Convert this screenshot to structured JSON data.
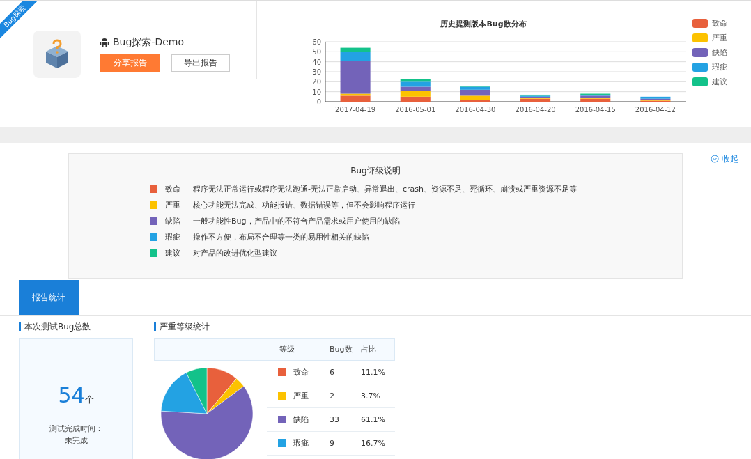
{
  "ribbon": "Bug探索",
  "app": {
    "name": "Bug探索-Demo",
    "buttons": [
      {
        "label": "分享报告",
        "kind": "primary"
      },
      {
        "label": "导出报告",
        "kind": "outline"
      }
    ]
  },
  "history_chart": {
    "chart_data": {
      "type": "bar",
      "stacked": true,
      "grid": true,
      "title": "历史提测版本Bug数分布",
      "categories": [
        "2017-04-19",
        "2016-05-01",
        "2016-04-30",
        "2016-04-20",
        "2016-04-15",
        "2016-04-12"
      ],
      "ylim": [
        0,
        60
      ],
      "yticks": [
        0,
        10,
        20,
        30,
        40,
        50,
        60
      ],
      "series": [
        {
          "name": "致命",
          "color": "#e8603c",
          "values": [
            6,
            5,
            2,
            3,
            3,
            1
          ]
        },
        {
          "name": "严重",
          "color": "#fcc200",
          "values": [
            2,
            6,
            4,
            1,
            1,
            1
          ]
        },
        {
          "name": "缺陷",
          "color": "#7363b9",
          "values": [
            33,
            4,
            6,
            1,
            2,
            1
          ]
        },
        {
          "name": "瑕疵",
          "color": "#23a2e3",
          "values": [
            9,
            5,
            3,
            1,
            1,
            2
          ]
        },
        {
          "name": "建议",
          "color": "#13c28a",
          "values": [
            4,
            3,
            1,
            1,
            1,
            0
          ]
        }
      ]
    }
  },
  "grading": {
    "title": "Bug评级说明",
    "collapse": "收起",
    "levels": [
      {
        "name": "致命",
        "color": "#e8603c",
        "desc": "程序无法正常运行或程序无法跑通-无法正常启动、异常退出、crash、资源不足、死循环、崩溃或严重资源不足等"
      },
      {
        "name": "严重",
        "color": "#fcc200",
        "desc": "核心功能无法完成、功能报错、数据错误等，但不会影响程序运行"
      },
      {
        "name": "缺陷",
        "color": "#7363b9",
        "desc": "一般功能性Bug，产品中的不符合产品需求或用户使用的缺陷"
      },
      {
        "name": "瑕疵",
        "color": "#23a2e3",
        "desc": "操作不方便，布局不合理等一类的易用性相关的缺陷"
      },
      {
        "name": "建议",
        "color": "#13c28a",
        "desc": "对产品的改进优化型建议"
      }
    ]
  },
  "tabs": [
    {
      "label": "报告统计",
      "selected": true
    }
  ],
  "total": {
    "title": "本次测试Bug总数",
    "count": "54",
    "unit": "个",
    "time_label": "测试完成时间：",
    "time_value": "未完成"
  },
  "severity": {
    "title": "严重等级统计",
    "columns": [
      "等级",
      "Bug数",
      "占比"
    ],
    "rows": [
      {
        "name": "致命",
        "color": "#e8603c",
        "count": "6",
        "share": "11.1%"
      },
      {
        "name": "严重",
        "color": "#fcc200",
        "count": "2",
        "share": "3.7%"
      },
      {
        "name": "缺陷",
        "color": "#7363b9",
        "count": "33",
        "share": "61.1%"
      },
      {
        "name": "瑕疵",
        "color": "#23a2e3",
        "count": "9",
        "share": "16.7%"
      }
    ]
  }
}
